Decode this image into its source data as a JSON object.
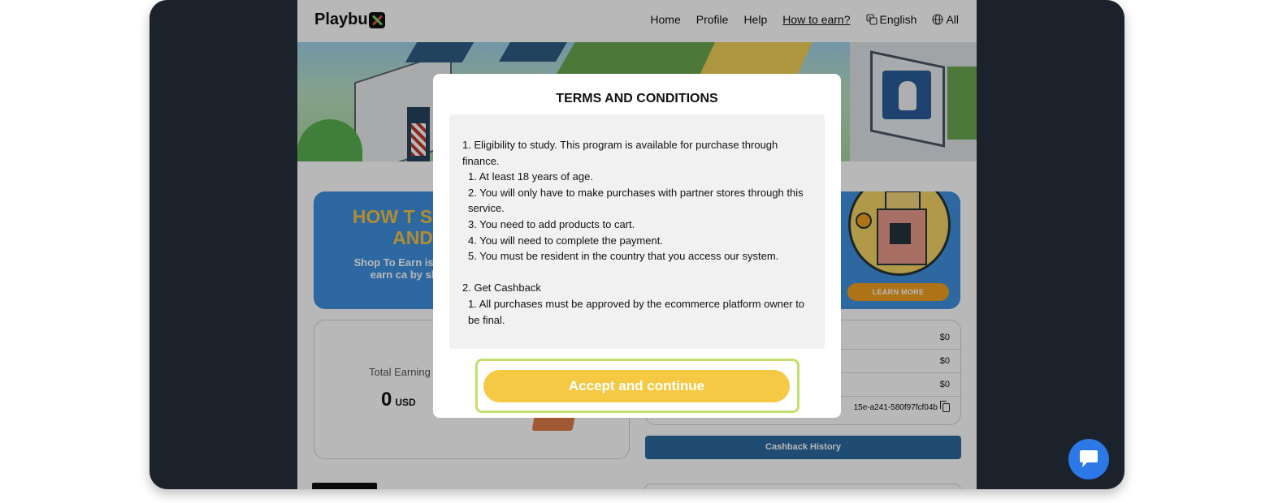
{
  "header": {
    "logo": "Playbu",
    "nav": {
      "home": "Home",
      "profile": "Profile",
      "help": "Help",
      "how_to_earn": "How to earn?",
      "language": "English",
      "region": "All"
    }
  },
  "promo": {
    "title": "HOW T SHOP AND",
    "subtitle": "Shop To Earn is you can earn ca by shoppi",
    "learn_more": "LEARN MORE"
  },
  "earnings": {
    "label": "Total Earning",
    "value": "0",
    "unit": "USD"
  },
  "stats": {
    "rows": [
      "$0",
      "$0",
      "$0"
    ],
    "referral_code": "15e-a241-580f97fcf04b"
  },
  "cashback_history": "Cashback History",
  "modal": {
    "title": "TERMS AND CONDITIONS",
    "lines": [
      "1. Eligibility to study. This program is available for purchase through finance.",
      "1. At least 18 years of age.",
      "2. You will only have to make purchases with partner stores through this service.",
      "3. You need to add products to cart.",
      "4. You will need to complete the payment.",
      "5. You must be resident in the country that you access our system.",
      "2. Get Cashback",
      "1. All purchases must be approved by the ecommerce platform owner to",
      "be final."
    ],
    "accept_button": "Accept and continue"
  },
  "colors": {
    "accent": "#f6c944",
    "focus_ring": "#c3e06f",
    "chat": "#2b78e6",
    "promo_bg": "#3f90e0"
  },
  "icons": [
    "translate-icon",
    "globe-icon",
    "copy-icon",
    "chat-icon"
  ]
}
